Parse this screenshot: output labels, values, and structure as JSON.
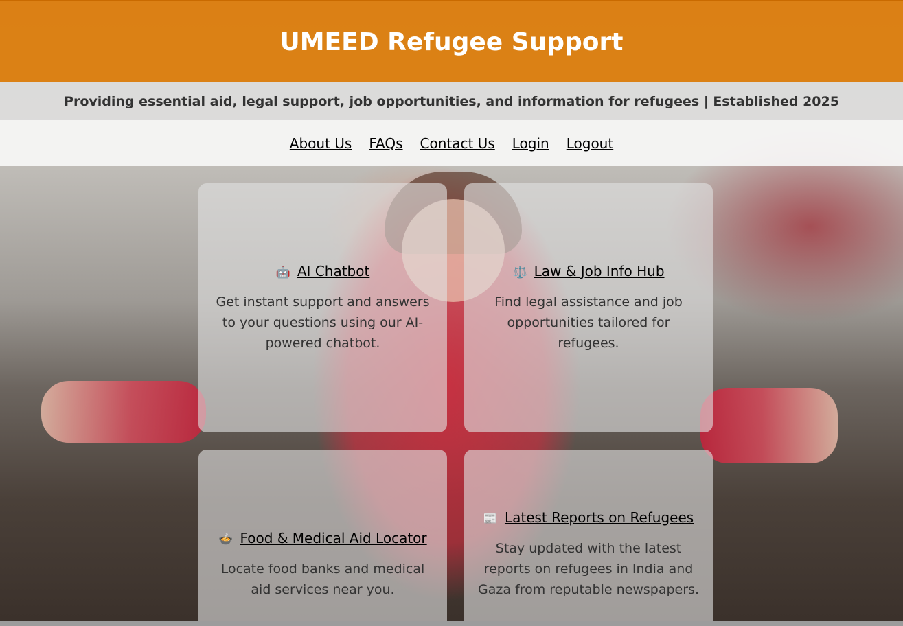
{
  "site": {
    "title": "UMEED Refugee Support",
    "tagline": "Providing essential aid, legal support, job opportunities, and information for refugees | Established 2025"
  },
  "nav": {
    "items": [
      {
        "label": "About Us"
      },
      {
        "label": "FAQs"
      },
      {
        "label": "Contact Us"
      },
      {
        "label": "Login"
      },
      {
        "label": "Logout"
      }
    ]
  },
  "cards": [
    {
      "icon": "🤖",
      "icon_name": "robot-icon",
      "title": "AI Chatbot",
      "description": "Get instant support and answers to your questions using our AI-powered chatbot."
    },
    {
      "icon": "⚖️",
      "icon_name": "scales-icon",
      "title": "Law & Job Info Hub",
      "description": "Find legal assistance and job opportunities tailored for refugees."
    },
    {
      "icon": "🍲",
      "icon_name": "food-bowl-icon",
      "title": "Food & Medical Aid Locator",
      "description": "Locate food banks and medical aid services near you."
    },
    {
      "icon": "📰",
      "icon_name": "newspaper-icon",
      "title": "Latest Reports on Refugees",
      "description": "Stay updated with the latest reports on refugees in India and Gaza from reputable newspapers."
    }
  ],
  "colors": {
    "header": "#dd7c08",
    "header_text": "#ffffff",
    "tagline_text": "#333333",
    "link_text": "#000000"
  }
}
